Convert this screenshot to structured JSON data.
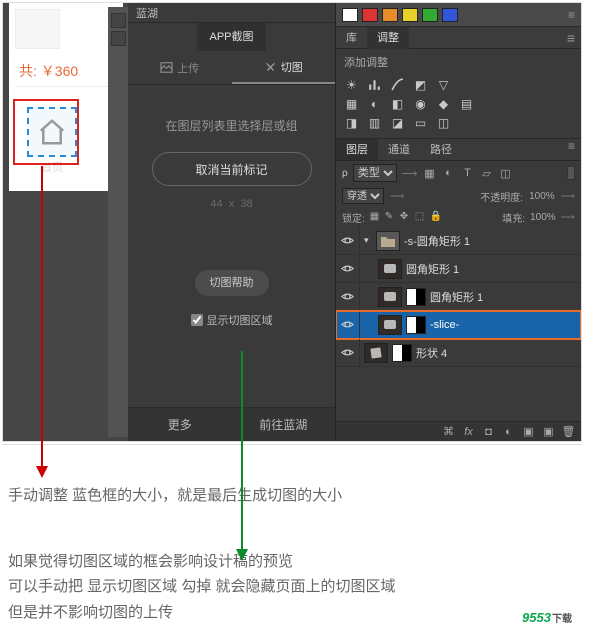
{
  "canvas": {
    "price": "共: ￥360",
    "home_label": "首页"
  },
  "plugin": {
    "brand": "蓝湖",
    "tab_app": "APP截图",
    "subtab_upload": "上传",
    "subtab_slice": "切图",
    "hint": "在图层列表里选择层或组",
    "cancel": "取消当前标记",
    "dim_w": "44",
    "dim_x": "x",
    "dim_h": "38",
    "help": "切图帮助",
    "show_area": "显示切图区域",
    "more": "更多",
    "goto": "前往蓝湖"
  },
  "ps": {
    "topTabs": {
      "lib": "库",
      "adjust": "调整"
    },
    "adj_title": "添加调整",
    "layersTabs": {
      "layers": "图层",
      "channels": "通道",
      "paths": "路径"
    },
    "filter_kind": "类型",
    "blend": "穿透",
    "opacity_label": "不透明度:",
    "opacity_val": "100%",
    "lock_label": "锁定:",
    "fill_label": "填充:",
    "fill_val": "100%",
    "layers": [
      {
        "name": "-s-圆角矩形 1",
        "kind": "group",
        "indent": 0,
        "open": true,
        "eye": true,
        "selected": false,
        "highlighted": false
      },
      {
        "name": "圆角矩形 1",
        "kind": "shape",
        "indent": 1,
        "eye": true,
        "selected": false,
        "highlighted": false
      },
      {
        "name": "圆角矩形 1",
        "kind": "shape",
        "indent": 1,
        "mask": true,
        "eye": true,
        "selected": false,
        "highlighted": false
      },
      {
        "name": "-slice-",
        "kind": "shape",
        "indent": 1,
        "mask": true,
        "eye": true,
        "selected": true,
        "highlighted": true
      },
      {
        "name": "形状 4",
        "kind": "shape2",
        "indent": 0,
        "mask": true,
        "eye": true,
        "selected": false,
        "highlighted": false
      }
    ]
  },
  "captions": {
    "c1": "手动调整 蓝色框的大小，就是最后生成切图的大小",
    "c2a": "如果觉得切图区域的框会影响设计稿的预览",
    "c2b": "可以手动把 显示切图区域 勾掉 就会隐藏页面上的切图区域",
    "c2c": "但是并不影响切图的上传"
  },
  "watermark": {
    "num": "9553",
    "txt": "下载"
  }
}
